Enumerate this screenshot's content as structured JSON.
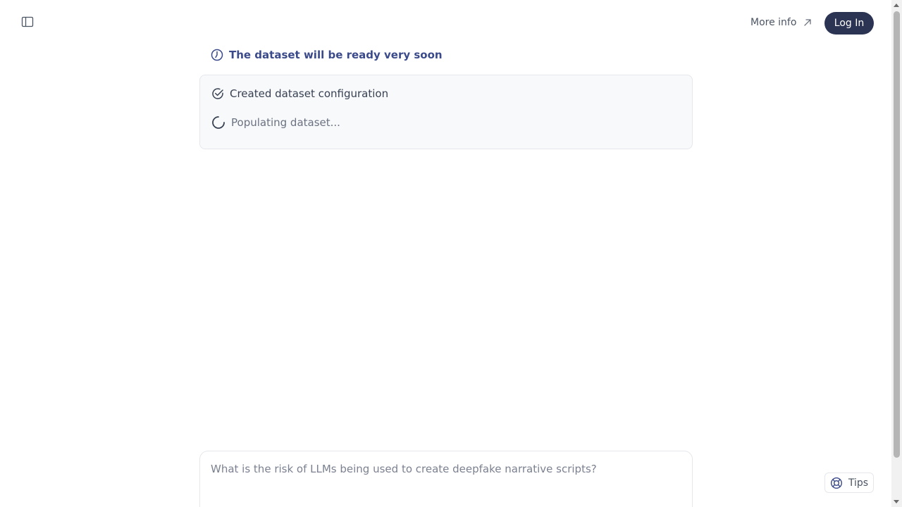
{
  "header": {
    "sidebar_toggle_icon": "sidebar-panel-icon",
    "more_info_label": "More info",
    "more_info_icon": "arrow-up-right-icon",
    "login_label": "Log In"
  },
  "status": {
    "title": "The dataset will be ready very soon",
    "icon": "clock-icon",
    "color": "#3b4a8a"
  },
  "steps": [
    {
      "label": "Created dataset configuration",
      "state": "done",
      "icon": "check-circle-icon"
    },
    {
      "label": "Populating dataset...",
      "state": "in-progress",
      "icon": "spinner-icon"
    }
  ],
  "chat": {
    "placeholder": "What is the risk of LLMs being used to create deepfake narrative scripts?",
    "value": ""
  },
  "tips": {
    "label": "Tips",
    "icon": "lifebuoy-icon"
  },
  "colors": {
    "login_bg": "#2b3452",
    "card_bg": "#f8f9fb"
  }
}
